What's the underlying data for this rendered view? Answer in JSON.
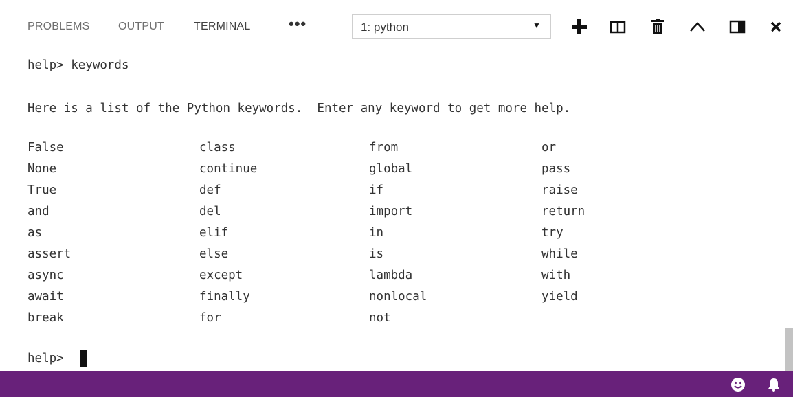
{
  "tabs": [
    {
      "label": "PROBLEMS"
    },
    {
      "label": "OUTPUT"
    },
    {
      "label": "TERMINAL"
    }
  ],
  "more_label": "•••",
  "terminal_select": {
    "value": "1: python"
  },
  "toolbar_icons": [
    "plus-icon",
    "split-icon",
    "trash-icon",
    "chevron-up-icon",
    "maximize-panel-icon",
    "close-icon"
  ],
  "terminal": {
    "command_line": "help> keywords",
    "intro": "Here is a list of the Python keywords.  Enter any keyword to get more help.",
    "keywords": [
      [
        "False",
        "class",
        "from",
        "or"
      ],
      [
        "None",
        "continue",
        "global",
        "pass"
      ],
      [
        "True",
        "def",
        "if",
        "raise"
      ],
      [
        "and",
        "del",
        "import",
        "return"
      ],
      [
        "as",
        "elif",
        "in",
        "try"
      ],
      [
        "assert",
        "else",
        "is",
        "while"
      ],
      [
        "async",
        "except",
        "lambda",
        "with"
      ],
      [
        "await",
        "finally",
        "nonlocal",
        "yield"
      ],
      [
        "break",
        "for",
        "not",
        ""
      ]
    ],
    "prompt": "help>"
  },
  "status_bar": {
    "color": "#68217a",
    "icons": [
      "smiley-icon",
      "bell-icon"
    ]
  }
}
